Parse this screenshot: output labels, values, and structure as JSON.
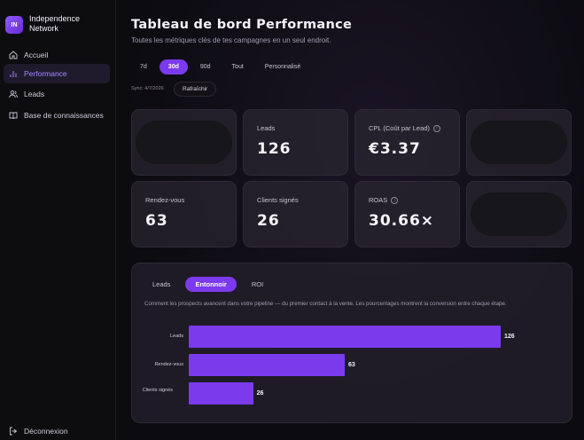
{
  "brand": {
    "logo": "IN",
    "name": "Independence Network"
  },
  "nav": [
    {
      "label": "Accueil",
      "icon": "home-icon"
    },
    {
      "label": "Performance",
      "icon": "bar-chart-icon",
      "active": true
    },
    {
      "label": "Leads",
      "icon": "users-icon"
    },
    {
      "label": "Base de connaissances",
      "icon": "book-icon"
    }
  ],
  "logout": "Déconnexion",
  "header": {
    "title": "Tableau de bord Performance",
    "subtitle": "Toutes les métriques clés de tes campagnes en un seul endroit."
  },
  "ranges": [
    {
      "label": "7d"
    },
    {
      "label": "30d",
      "active": true
    },
    {
      "label": "90d"
    },
    {
      "label": "Tout"
    },
    {
      "label": "Personnalisé"
    }
  ],
  "sync": {
    "text": "Sync: 4/7/2026",
    "refresh_label": "Rafraîchir"
  },
  "cards": {
    "leads": {
      "label": "Leads",
      "value": "126"
    },
    "cpl": {
      "label": "CPL (Coût par Lead)",
      "value": "€3.37"
    },
    "rdv": {
      "label": "Rendez-vous",
      "value": "63"
    },
    "clients": {
      "label": "Clients signés",
      "value": "26"
    },
    "roas": {
      "label": "ROAS",
      "value": "30.66×"
    }
  },
  "funnel": {
    "tabs": [
      {
        "label": "Leads"
      },
      {
        "label": "Entonnoir",
        "active": true
      },
      {
        "label": "ROI"
      }
    ],
    "description": "Comment les prospects avancent dans votre pipeline — du premier contact à la vente. Les pourcentages montrent la conversion entre chaque étape."
  },
  "chart_data": {
    "type": "bar",
    "orientation": "horizontal",
    "categories": [
      "Leads",
      "Rendez-vous",
      "Clients signés"
    ],
    "values": [
      126,
      63,
      26
    ],
    "color": "#7c3aed"
  },
  "colors": {
    "accent": "#7c3aed",
    "accent_light": "#a78bfa"
  }
}
